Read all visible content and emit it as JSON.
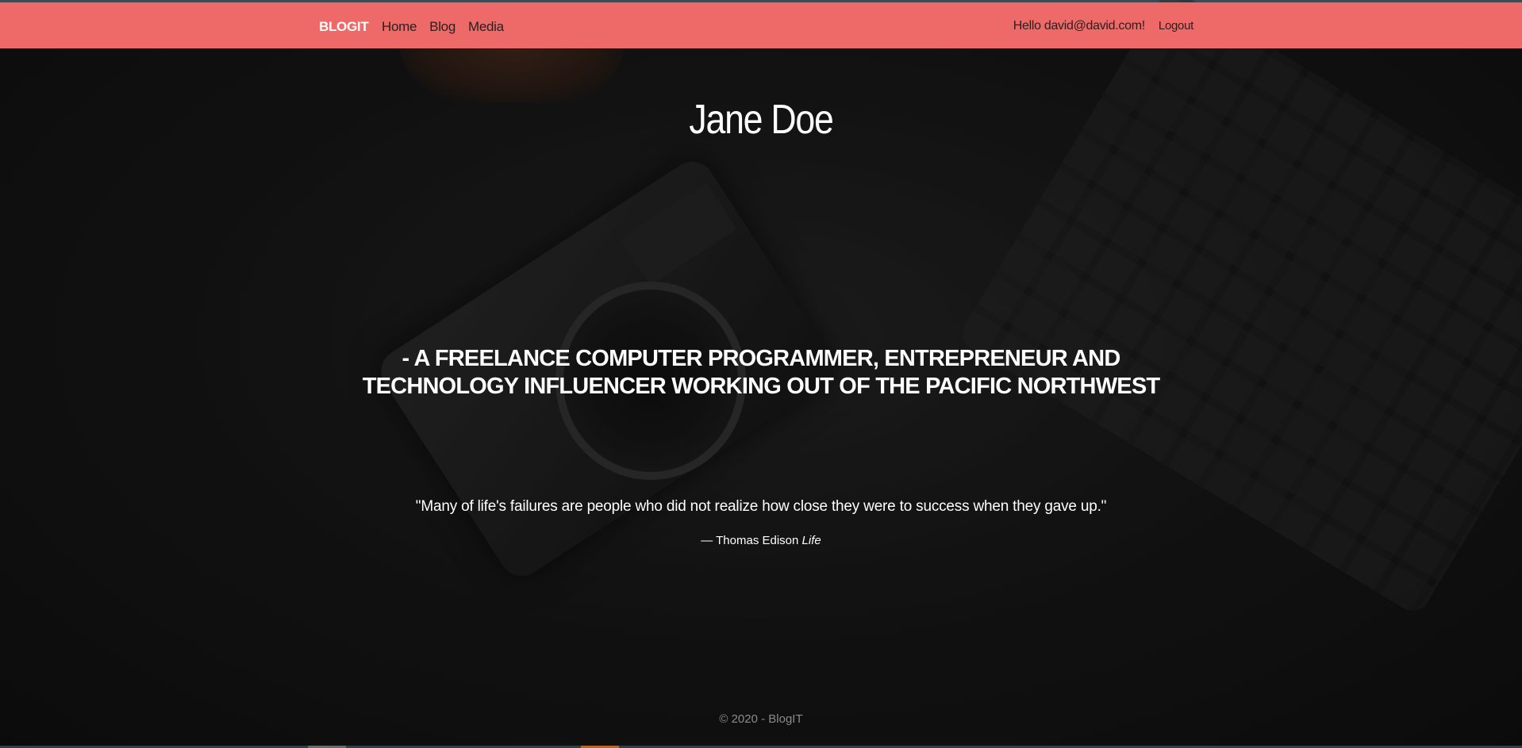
{
  "navbar": {
    "brand": "BLOGIT",
    "links": [
      "Home",
      "Blog",
      "Media"
    ],
    "greeting": "Hello david@david.com!",
    "logout_label": "Logout",
    "background_color": "#ee6a68"
  },
  "hero": {
    "name": "Jane Doe",
    "tagline": "- A freelance computer programmer, entrepreneur and technology influencer working out of the Pacific Northwest",
    "quote": "\"Many of life's failures are people who did not realize how close they were to success when they gave up.\"",
    "quote_author": "— Thomas Edison",
    "quote_source": "Life"
  },
  "footer": {
    "copyright": "© 2020 - BlogIT"
  }
}
